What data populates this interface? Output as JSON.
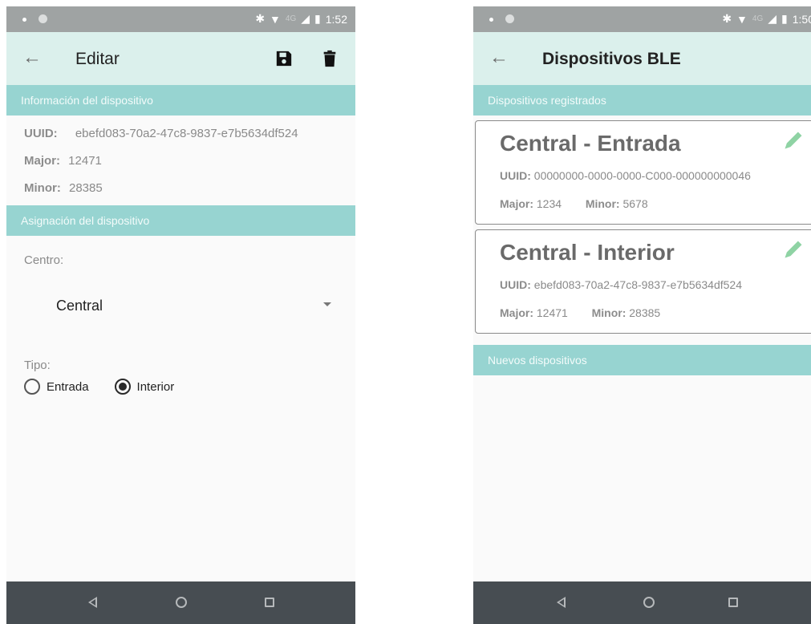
{
  "left": {
    "status": {
      "time": "1:52",
      "bluetooth": "✱",
      "wifi": "▼",
      "lte": "4G",
      "signal": "◢",
      "battery": "▮"
    },
    "appbar": {
      "back": "←",
      "title": "Editar"
    },
    "section_info": "Información del dispositivo",
    "info": {
      "uuid_label": "UUID:",
      "uuid_value": "ebefd083-70a2-47c8-9837-e7b5634df524",
      "major_label": "Major:",
      "major_value": "12471",
      "minor_label": "Minor:",
      "minor_value": "28385"
    },
    "section_assign": "Asignación del dispositivo",
    "centro_label": "Centro:",
    "centro_value": "Central",
    "tipo_label": "Tipo:",
    "tipo_options": [
      "Entrada",
      "Interior"
    ],
    "tipo_selected": "Interior"
  },
  "right": {
    "status": {
      "time": "1:50",
      "bluetooth": "✱",
      "wifi": "▼",
      "lte": "4G",
      "signal": "◢",
      "battery": "▮"
    },
    "appbar": {
      "back": "←",
      "title": "Dispositivos BLE"
    },
    "section_registered": "Dispositivos registrados",
    "devices": [
      {
        "title": "Central - Entrada",
        "uuid_label": "UUID:",
        "uuid": "00000000-0000-0000-C000-000000000046",
        "major_label": "Major:",
        "major": "1234",
        "minor_label": "Minor:",
        "minor": "5678"
      },
      {
        "title": "Central - Interior",
        "uuid_label": "UUID:",
        "uuid": "ebefd083-70a2-47c8-9837-e7b5634df524",
        "major_label": "Major:",
        "major": "12471",
        "minor_label": "Minor:",
        "minor": "28385"
      }
    ],
    "section_new": "Nuevos dispositivos"
  },
  "colors": {
    "appbar": "#dbf0ec",
    "section": "#97d4d1",
    "navbar": "#474d52",
    "statusbar": "#9fa3a3",
    "pencil": "#8fd3a4"
  },
  "icons": {
    "save": "save-icon",
    "delete": "trash-icon",
    "edit": "pencil-icon",
    "back": "arrow-left-icon"
  }
}
